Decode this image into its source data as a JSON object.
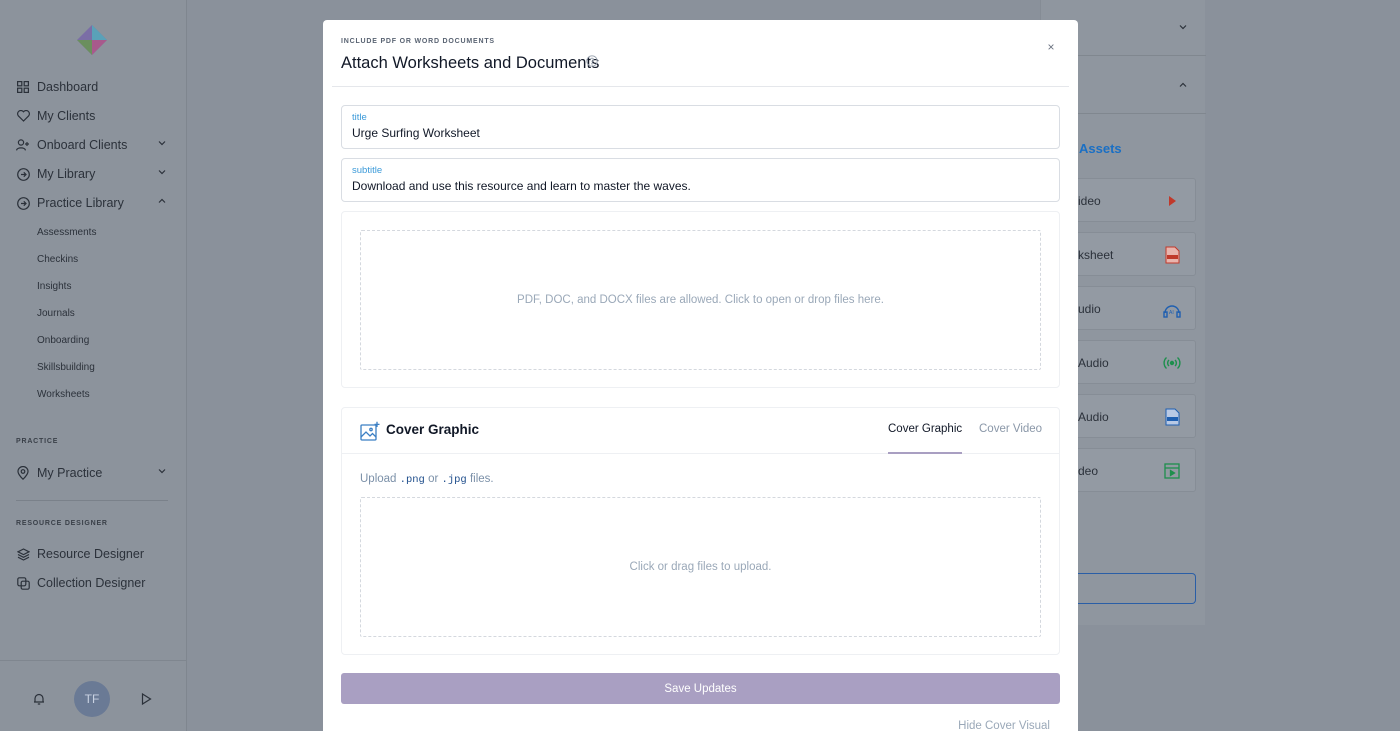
{
  "sidebar": {
    "nav": [
      {
        "label": "Dashboard",
        "icon": "grid-icon"
      },
      {
        "label": "My Clients",
        "icon": "heart-icon"
      },
      {
        "label": "Onboard Clients",
        "icon": "user-plus-icon"
      },
      {
        "label": "My Library",
        "icon": "circle-arrow-icon"
      },
      {
        "label": "Practice Library",
        "icon": "circle-arrow-icon"
      }
    ],
    "practice_library_items": [
      "Assessments",
      "Checkins",
      "Insights",
      "Journals",
      "Onboarding",
      "Skillsbuilding",
      "Worksheets"
    ],
    "practice_section_label": "PRACTICE",
    "my_practice_label": "My Practice",
    "resource_designer_section_label": "RESOURCE DESIGNER",
    "resource_designer_label": "Resource Designer",
    "collection_designer_label": "Collection Designer",
    "avatar_initials": "TF"
  },
  "background": {
    "assets_title": "Assets",
    "cards": [
      {
        "label": "ideo",
        "icon": "play-icon",
        "color": "#c0392b"
      },
      {
        "label": "ksheet",
        "icon": "pdf-icon",
        "color": "#c0392b"
      },
      {
        "label": "udio",
        "icon": "ai-audio-icon",
        "color": "#1f5fb0"
      },
      {
        "label": "Audio",
        "icon": "broadcast-icon",
        "color": "#1e8f4d"
      },
      {
        "label": "Audio",
        "icon": "audio-file-icon",
        "color": "#1f5fb0"
      },
      {
        "label": "deo",
        "icon": "video-file-icon",
        "color": "#1e8f4d"
      }
    ]
  },
  "modal": {
    "eyebrow": "INCLUDE PDF OR WORD DOCUMENTS",
    "title": "Attach Worksheets and Documents",
    "close_label": "×",
    "title_field": {
      "label": "title",
      "value": "Urge Surfing Worksheet"
    },
    "subtitle_field": {
      "label": "subtitle",
      "value": "Download and use this resource and learn to master the waves."
    },
    "doc_dropzone_text": "PDF, DOC, and DOCX files are allowed. Click to open or drop files here.",
    "cover": {
      "title": "Cover Graphic",
      "tabs": [
        {
          "label": "Cover Graphic",
          "active": true
        },
        {
          "label": "Cover Video",
          "active": false
        }
      ],
      "upload_prefix": "Upload",
      "ext_png": ".png",
      "or_text": "or",
      "ext_jpg": ".jpg",
      "upload_suffix": "files.",
      "dropzone_text": "Click or drag files to upload."
    },
    "save_label": "Save Updates",
    "hide_label": "Hide Cover Visual"
  },
  "colors": {
    "accent_purple": "#a99fc2",
    "link_blue": "#3b9ad9",
    "overlay_gray": "#8a919b"
  }
}
